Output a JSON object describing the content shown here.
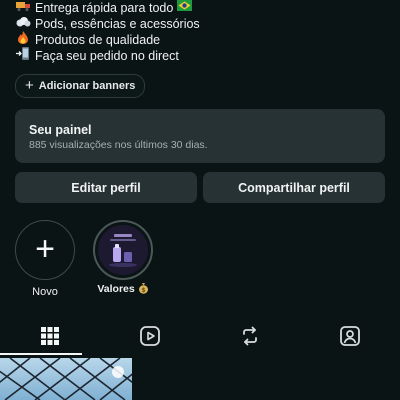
{
  "bio": {
    "lines": [
      {
        "icon": "truck-icon",
        "text": "Entrega rápida para todo",
        "tail_icon": "brazil-flag-icon"
      },
      {
        "icon": "vapor-cloud-icon",
        "text": "Pods, essências e acessórios"
      },
      {
        "icon": "fire-icon",
        "text": "Produtos de qualidade"
      },
      {
        "icon": "phone-arrow-icon",
        "text": "Faça seu pedido no direct"
      }
    ]
  },
  "banners": {
    "label": "Adicionar banners"
  },
  "panel": {
    "title": "Seu painel",
    "subtitle": "885 visualizações nos últimos 30 dias."
  },
  "buttons": {
    "edit": "Editar perfil",
    "share": "Compartilhar perfil"
  },
  "highlights": [
    {
      "label": "Novo"
    },
    {
      "label": "Valores",
      "icon": "money-bag-icon"
    }
  ],
  "tabs": [
    {
      "name": "grid-icon",
      "active": true
    },
    {
      "name": "reels-icon",
      "active": false
    },
    {
      "name": "reposts-icon",
      "active": false
    },
    {
      "name": "tagged-icon",
      "active": false
    }
  ],
  "colors": {
    "background": "#0a1414",
    "card": "#263233",
    "text": "#f2f4f4",
    "muted": "#a7b0b0"
  }
}
